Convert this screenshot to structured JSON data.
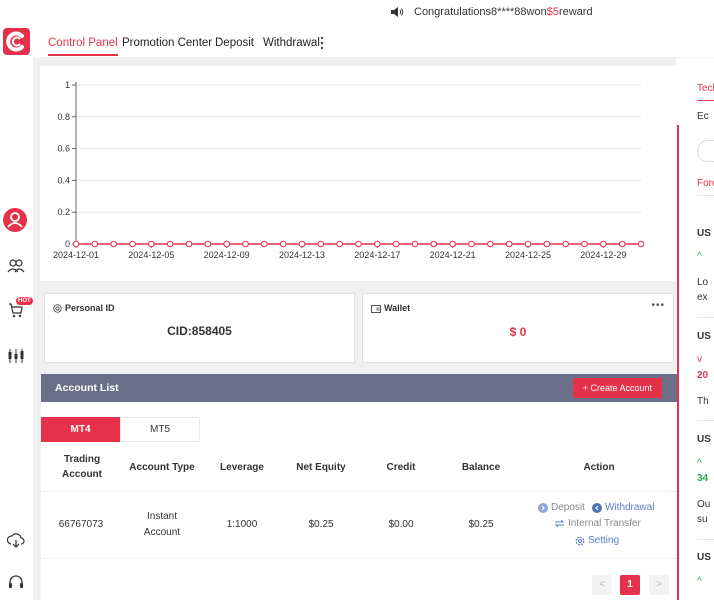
{
  "notice": {
    "prefix": "Congratulations8****88won",
    "amount": "$5",
    "suffix": "reward"
  },
  "nav": {
    "tabs": [
      "Control Panel",
      "Promotion Center",
      "Deposit",
      "Withdrawal"
    ]
  },
  "sidebar": {
    "hot_badge": "HOT"
  },
  "chart_data": {
    "type": "line",
    "x": [
      "2024-12-01",
      "2024-12-02",
      "2024-12-03",
      "2024-12-04",
      "2024-12-05",
      "2024-12-06",
      "2024-12-07",
      "2024-12-08",
      "2024-12-09",
      "2024-12-10",
      "2024-12-11",
      "2024-12-12",
      "2024-12-13",
      "2024-12-14",
      "2024-12-15",
      "2024-12-16",
      "2024-12-17",
      "2024-12-18",
      "2024-12-19",
      "2024-12-20",
      "2024-12-21",
      "2024-12-22",
      "2024-12-23",
      "2024-12-24",
      "2024-12-25",
      "2024-12-26",
      "2024-12-27",
      "2024-12-28",
      "2024-12-29",
      "2024-12-30",
      "2024-12-31"
    ],
    "series": [
      {
        "values": [
          0,
          0,
          0,
          0,
          0,
          0,
          0,
          0,
          0,
          0,
          0,
          0,
          0,
          0,
          0,
          0,
          0,
          0,
          0,
          0,
          0,
          0,
          0,
          0,
          0,
          0,
          0,
          0,
          0,
          0,
          0
        ]
      }
    ],
    "xtick_labels": [
      "2024-12-01",
      "2024-12-05",
      "2024-12-09",
      "2024-12-13",
      "2024-12-17",
      "2024-12-21",
      "2024-12-25",
      "2024-12-29"
    ],
    "ytick_labels": [
      "0",
      "0.2",
      "0.4",
      "0.6",
      "0.8",
      "1"
    ],
    "ylim": [
      0,
      1
    ],
    "grid": true,
    "color": "#e5324a"
  },
  "personal": {
    "title": "Personal ID",
    "cid": "CID:858405"
  },
  "wallet": {
    "title": "Wallet",
    "amount": "$ 0",
    "more": "•••"
  },
  "account_list": {
    "title": "Account List",
    "create_label": "+ Create Account",
    "tabs": [
      "MT4",
      "MT5"
    ],
    "headers": [
      "Trading Account",
      "Account Type",
      "Leverage",
      "Net Equity",
      "Credit",
      "Balance",
      "Action"
    ],
    "rows": [
      {
        "account": "66767073",
        "type": "Instant Account",
        "leverage": "1:1000",
        "equity": "$0.25",
        "credit": "$0.00",
        "balance": "$0.25",
        "actions": {
          "deposit": "Deposit",
          "withdrawal": "Withdrawal",
          "transfer": "Internal Transfer",
          "setting": "Setting"
        }
      }
    ],
    "pagination": {
      "prev": "<",
      "current": "1",
      "next": ">"
    }
  },
  "right_panel": {
    "tab1": "Tech",
    "field": "Ec",
    "tab2": "Fore",
    "items": [
      {
        "title": "US",
        "arrow": "^",
        "lines": [
          "Lo",
          "ex"
        ]
      },
      {
        "title": "US",
        "arrow": "v",
        "value": "20",
        "lines": [
          "Th"
        ]
      },
      {
        "title": "US",
        "arrow": "^",
        "value": "34",
        "lines": [
          "Ou",
          "su"
        ]
      },
      {
        "title": "US",
        "arrow": "^"
      }
    ]
  }
}
